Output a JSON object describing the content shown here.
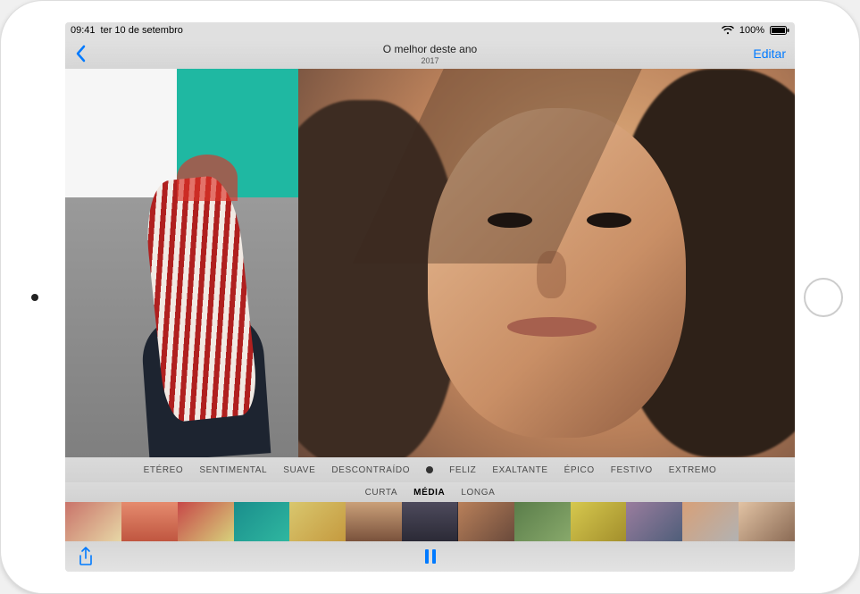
{
  "status": {
    "time": "09:41",
    "date": "ter 10 de setembro",
    "battery": "100%"
  },
  "nav": {
    "title": "O melhor deste ano",
    "subtitle": "2017",
    "edit_label": "Editar"
  },
  "moods": {
    "items": [
      "ETÉREO",
      "SENTIMENTAL",
      "SUAVE",
      "DESCONTRAÍDO",
      "●",
      "FELIZ",
      "EXALTANTE",
      "ÉPICO",
      "FESTIVO",
      "EXTREMO"
    ],
    "selected_index": 4
  },
  "lengths": {
    "items": [
      "CURTA",
      "MÉDIA",
      "LONGA"
    ],
    "selected_index": 1
  },
  "thumbnails": {
    "count": 13,
    "current_index": 7
  },
  "icons": {
    "back": "chevron-left",
    "share": "share",
    "pause": "pause",
    "wifi": "wifi",
    "battery": "battery-full"
  }
}
